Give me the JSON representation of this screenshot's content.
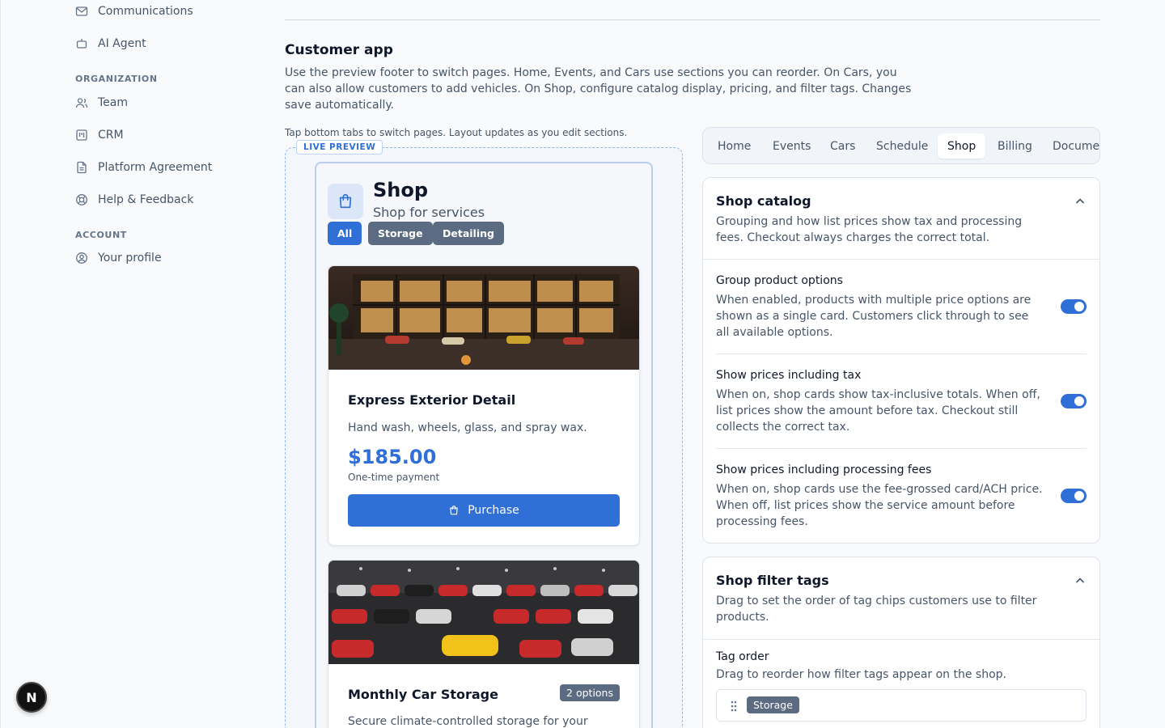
{
  "sidebar": {
    "items_top": [
      {
        "label": "Communications",
        "icon": "mail-icon"
      },
      {
        "label": "AI Agent",
        "icon": "bot-icon"
      }
    ],
    "organization_label": "ORGANIZATION",
    "organization_items": [
      {
        "label": "Team",
        "icon": "users-icon"
      },
      {
        "label": "CRM",
        "icon": "kanban-icon"
      },
      {
        "label": "Platform Agreement",
        "icon": "file-text-icon"
      },
      {
        "label": "Help & Feedback",
        "icon": "life-buoy-icon"
      }
    ],
    "account_label": "ACCOUNT",
    "account_items": [
      {
        "label": "Your profile",
        "icon": "user-circle-icon"
      }
    ],
    "dev_badge": "N"
  },
  "main": {
    "title": "Customer app",
    "description": "Use the preview footer to switch pages. Home, Events, and Cars use sections you can reorder. On Cars, you can also allow customers to add vehicles. On Shop, configure catalog display, pricing, and filter tags. Changes save automatically.",
    "preview_hint": "Tap bottom tabs to switch pages. Layout updates as you edit sections."
  },
  "preview": {
    "label": "LIVE PREVIEW",
    "shop_title": "Shop",
    "shop_subtitle": "Shop for services",
    "chips": [
      "All",
      "Storage",
      "Detailing"
    ],
    "active_chip": "All",
    "cards": [
      {
        "title": "Express Exterior Detail",
        "description": "Hand wash, wheels, glass, and spray wax.",
        "price": "$185.00",
        "price_note": "One-time payment",
        "button": "Purchase"
      },
      {
        "title": "Monthly Car Storage",
        "badge": "2 options",
        "description": "Secure climate-controlled storage for your"
      }
    ]
  },
  "tabs": {
    "items": [
      "Home",
      "Events",
      "Cars",
      "Schedule",
      "Shop",
      "Billing",
      "Documen"
    ],
    "active": "Shop"
  },
  "shop_catalog": {
    "title": "Shop catalog",
    "description": "Grouping and how list prices show tax and processing fees. Checkout always charges the correct total.",
    "settings": [
      {
        "title": "Group product options",
        "description": "When enabled, products with multiple price options are shown as a single card. Customers click through to see all available options.",
        "enabled": true
      },
      {
        "title": "Show prices including tax",
        "description": "When on, shop cards show tax-inclusive totals. When off, list prices show the amount before tax. Checkout still collects the correct tax.",
        "enabled": true
      },
      {
        "title": "Show prices including processing fees",
        "description": "When on, shop cards use the fee-grossed card/ACH price. When off, list prices show the service amount before processing fees.",
        "enabled": true
      }
    ]
  },
  "shop_filter_tags": {
    "title": "Shop filter tags",
    "description": "Drag to set the order of tag chips customers use to filter products.",
    "tag_order_title": "Tag order",
    "tag_order_desc": "Drag to reorder how filter tags appear on the shop.",
    "tags": [
      "Storage"
    ]
  },
  "colors": {
    "accent": "#2f6fd6",
    "chip_inactive": "#5b6b82"
  }
}
